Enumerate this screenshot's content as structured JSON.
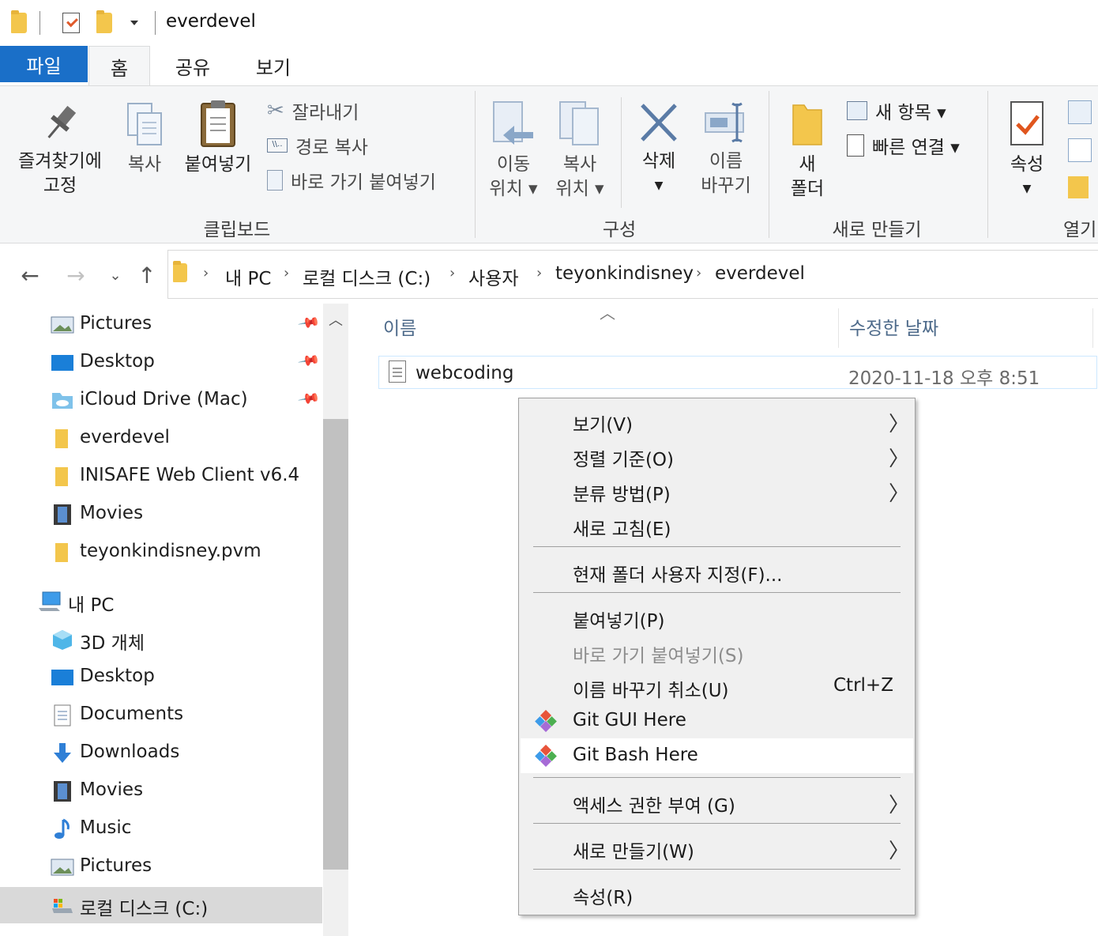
{
  "window": {
    "title": "everdevel"
  },
  "ribbon_tabs": [
    "파일",
    "홈",
    "공유",
    "보기"
  ],
  "ribbon": {
    "clipboard": {
      "pin_line1": "즐겨찾기에",
      "pin_line2": "고정",
      "copy": "복사",
      "paste": "붙여넣기",
      "cut": "잘라내기",
      "copy_path": "경로 복사",
      "paste_shortcut": "바로 가기 붙여넣기",
      "label": "클립보드"
    },
    "organize": {
      "move_line1": "이동",
      "move_line2": "위치 ▾",
      "copyto_line1": "복사",
      "copyto_line2": "위치 ▾",
      "delete": "삭제",
      "rename_line1": "이름",
      "rename_line2": "바꾸기",
      "label": "구성"
    },
    "new": {
      "folder_line1": "새",
      "folder_line2": "폴더",
      "new_item": "새 항목 ▾",
      "easy_access": "빠른 연결 ▾",
      "label": "새로 만들기"
    },
    "open": {
      "properties": "속성",
      "label": "열기"
    }
  },
  "address": {
    "crumbs": [
      "내 PC",
      "로컬 디스크 (C:)",
      "사용자",
      "teyonkindisney",
      "everdevel"
    ]
  },
  "nav_pane": {
    "quick_access": [
      {
        "label": "Pictures",
        "icon": "pictures-icon",
        "pinned": true
      },
      {
        "label": "Desktop",
        "icon": "desktop-icon",
        "pinned": true
      },
      {
        "label": "iCloud Drive (Mac)",
        "icon": "cloud-folder-icon",
        "pinned": true
      },
      {
        "label": "everdevel",
        "icon": "folder-icon",
        "pinned": false
      },
      {
        "label": "INISAFE Web Client v6.4",
        "icon": "folder-icon",
        "pinned": false
      },
      {
        "label": "Movies",
        "icon": "movies-icon",
        "pinned": false
      },
      {
        "label": "teyonkindisney.pvm",
        "icon": "folder-icon",
        "pinned": false
      }
    ],
    "this_pc_label": "내 PC",
    "this_pc": [
      {
        "label": "3D 개체",
        "icon": "cube-icon"
      },
      {
        "label": "Desktop",
        "icon": "desktop-icon"
      },
      {
        "label": "Documents",
        "icon": "documents-icon"
      },
      {
        "label": "Downloads",
        "icon": "downloads-icon"
      },
      {
        "label": "Movies",
        "icon": "movies-icon"
      },
      {
        "label": "Music",
        "icon": "music-icon"
      },
      {
        "label": "Pictures",
        "icon": "pictures-icon"
      },
      {
        "label": "로컬 디스크 (C:)",
        "icon": "drive-icon",
        "selected": true
      }
    ]
  },
  "file_list": {
    "columns": {
      "name": "이름",
      "modified": "수정한 날짜"
    },
    "rows": [
      {
        "name": "webcoding",
        "modified": "2020-11-18 오후 8:51"
      }
    ]
  },
  "context_menu": {
    "view": "보기(V)",
    "sort_by": "정렬 기준(O)",
    "group_by": "분류 방법(P)",
    "refresh": "새로 고침(E)",
    "customize": "현재 폴더 사용자 지정(F)...",
    "paste": "붙여넣기(P)",
    "paste_shortcut": "바로 가기 붙여넣기(S)",
    "undo_rename": "이름 바꾸기 취소(U)",
    "undo_shortcut": "Ctrl+Z",
    "git_gui": "Git GUI Here",
    "git_bash": "Git Bash Here",
    "give_access": "액세스 권한 부여 (G)",
    "new": "새로 만들기(W)",
    "properties": "속성(R)"
  },
  "colors": {
    "file_tab": "#1a6fc8",
    "ribbon_bg": "#f5f6f7",
    "menu_bg": "#f0f0f0",
    "selection": "#d9d9d9",
    "header_text": "#4d6a8a"
  }
}
